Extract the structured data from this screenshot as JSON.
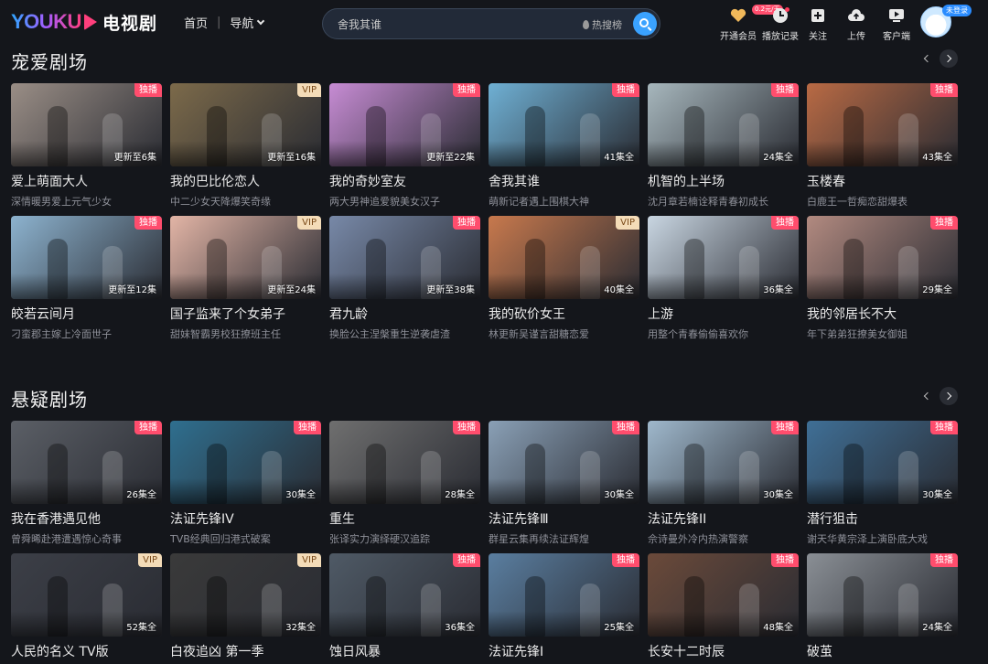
{
  "header": {
    "logo_en": "YOUKU",
    "logo_cn": "电视剧",
    "nav": {
      "home": "首页",
      "guide": "导航"
    },
    "search": {
      "placeholder": "舍我其谁",
      "hot": "热搜榜"
    },
    "tools": [
      {
        "label": "开通会员",
        "icon": "vip-heart-icon",
        "tag": "0.2元/天"
      },
      {
        "label": "播放记录",
        "icon": "history-clock-icon"
      },
      {
        "label": "关注",
        "icon": "follow-plus-icon"
      },
      {
        "label": "上传",
        "icon": "upload-cloud-icon"
      },
      {
        "label": "客户端",
        "icon": "client-play-icon"
      }
    ],
    "login_tag": "未登录"
  },
  "sections": [
    {
      "title": "宠爱剧场",
      "items": [
        {
          "title": "爱上萌面大人",
          "subtitle": "深情暖男爱上元气少女",
          "badge": "独播",
          "status": "更新至6集",
          "color": "#9a8e86"
        },
        {
          "title": "我的巴比伦恋人",
          "subtitle": "中二少女天降爆笑奇缘",
          "badge": "VIP",
          "status": "更新至16集",
          "color": "#7c6a4a"
        },
        {
          "title": "我的奇妙室友",
          "subtitle": "两大男神追爱貌美女汉子",
          "badge": "独播",
          "status": "更新至22集",
          "color": "#c78cd4"
        },
        {
          "title": "舍我其谁",
          "subtitle": "萌新记者遇上围棋大神",
          "badge": "独播",
          "status": "41集全",
          "color": "#6fb0d4"
        },
        {
          "title": "机智的上半场",
          "subtitle": "沈月章若楠诠释青春初成长",
          "badge": "独播",
          "status": "24集全",
          "color": "#a7b7bd"
        },
        {
          "title": "玉楼春",
          "subtitle": "白鹿王一哲痴恋甜爆表",
          "badge": "独播",
          "status": "43集全",
          "color": "#b96a44"
        },
        {
          "title": "皎若云间月",
          "subtitle": "刁蛮郡主嫁上冷面世子",
          "badge": "独播",
          "status": "更新至12集",
          "color": "#8db3cf"
        },
        {
          "title": "国子监来了个女弟子",
          "subtitle": "甜妹智霸男校狂撩班主任",
          "badge": "VIP",
          "status": "更新至24集",
          "color": "#e3b5a6"
        },
        {
          "title": "君九龄",
          "subtitle": "换脸公主涅槃重生逆袭虐渣",
          "badge": "独播",
          "status": "更新至38集",
          "color": "#7889a8"
        },
        {
          "title": "我的砍价女王",
          "subtitle": "林更新吴谨言甜糖恋爱",
          "badge": "VIP",
          "status": "40集全",
          "color": "#c8794d"
        },
        {
          "title": "上游",
          "subtitle": "用整个青春偷偷喜欢你",
          "badge": "独播",
          "status": "36集全",
          "color": "#c9d6e2"
        },
        {
          "title": "我的邻居长不大",
          "subtitle": "年下弟弟狂撩美女御姐",
          "badge": "独播",
          "status": "29集全",
          "color": "#b28a80"
        }
      ]
    },
    {
      "title": "悬疑剧场",
      "items": [
        {
          "title": "我在香港遇见他",
          "subtitle": "曾舜晞赴港遭遇惊心奇事",
          "badge": "独播",
          "status": "26集全",
          "color": "#5b5f66"
        },
        {
          "title": "法证先锋IV",
          "subtitle": "TVB经典回归港式破案",
          "badge": "独播",
          "status": "30集全",
          "color": "#2f6f8f"
        },
        {
          "title": "重生",
          "subtitle": "张译实力演绎硬汉追踪",
          "badge": "独播",
          "status": "28集全",
          "color": "#6f6f6f"
        },
        {
          "title": "法证先锋Ⅲ",
          "subtitle": "群星云集再续法证辉煌",
          "badge": "独播",
          "status": "30集全",
          "color": "#8aa0b6"
        },
        {
          "title": "法证先锋II",
          "subtitle": "佘诗曼外冷内热演警察",
          "badge": "独播",
          "status": "30集全",
          "color": "#9fb8cc"
        },
        {
          "title": "潜行狙击",
          "subtitle": "谢天华黄宗泽上演卧底大戏",
          "badge": "独播",
          "status": "30集全",
          "color": "#3f6f96"
        },
        {
          "title": "人民的名义 TV版",
          "subtitle": "",
          "badge": "VIP",
          "status": "52集全",
          "color": "#3c3f47"
        },
        {
          "title": "白夜追凶 第一季",
          "subtitle": "",
          "badge": "VIP",
          "status": "32集全",
          "color": "#3a3a3a"
        },
        {
          "title": "蚀日风暴",
          "subtitle": "",
          "badge": "独播",
          "status": "36集全",
          "color": "#4f5a66"
        },
        {
          "title": "法证先锋I",
          "subtitle": "",
          "badge": "独播",
          "status": "25集全",
          "color": "#5a7ea0"
        },
        {
          "title": "长安十二时辰",
          "subtitle": "",
          "badge": "独播",
          "status": "48集全",
          "color": "#6b4a3a"
        },
        {
          "title": "破茧",
          "subtitle": "",
          "badge": "独播",
          "status": "24集全",
          "color": "#8a8f95"
        }
      ]
    }
  ],
  "colors": {
    "background": "#14161b",
    "accent": "#3aa2ff",
    "badge_exclusive": "#ff4d6d",
    "badge_vip": "#f4dcb8"
  }
}
